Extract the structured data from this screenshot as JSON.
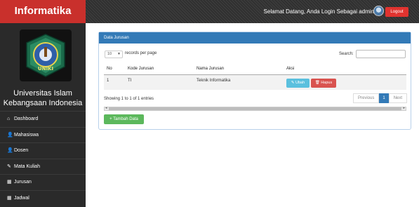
{
  "app": {
    "brand": "Informatika"
  },
  "header": {
    "welcome": "Selamat Datang,  Anda Login Sebagai admin",
    "logout_label": "Logout"
  },
  "sidebar": {
    "university_line1": "Universitas Islam",
    "university_line2": "Kebangsaan Indonesia",
    "logo_text": "UNIKI",
    "items": [
      {
        "label": "Dashboard",
        "icon": "home-icon",
        "glyph": "⌂"
      },
      {
        "label": "Mahasiswa",
        "icon": "user-icon",
        "glyph": "👤"
      },
      {
        "label": "Dosen",
        "icon": "user-icon",
        "glyph": "👤"
      },
      {
        "label": "Mata Kuliah",
        "icon": "edit-icon",
        "glyph": "✎"
      },
      {
        "label": "Jurusan",
        "icon": "table-icon",
        "glyph": "▦"
      },
      {
        "label": "Jadwal",
        "icon": "table-icon",
        "glyph": "▦"
      }
    ]
  },
  "panel": {
    "title": "Data Jurusan",
    "page_length": "10",
    "length_label": "records per page",
    "search_label": "Search:",
    "search_value": "",
    "columns": [
      "No",
      "Kode Jurusan",
      "Nama Jurusan",
      "Aksi"
    ],
    "rows": [
      {
        "no": "1",
        "kode": "TI",
        "nama": "Teknik Informatika"
      }
    ],
    "edit_label": "Ubah",
    "delete_label": "Hapus",
    "info": "Showing 1 to 1 of 1 entries",
    "pagination": {
      "previous": "Previous",
      "current": "1",
      "next": "Next"
    },
    "add_label": "+ Tambah Data"
  },
  "colors": {
    "brand_red": "#c9302c",
    "panel_blue": "#337ab7",
    "btn_info": "#5bc0de",
    "btn_danger": "#d9534f",
    "btn_success": "#5cb85c"
  }
}
